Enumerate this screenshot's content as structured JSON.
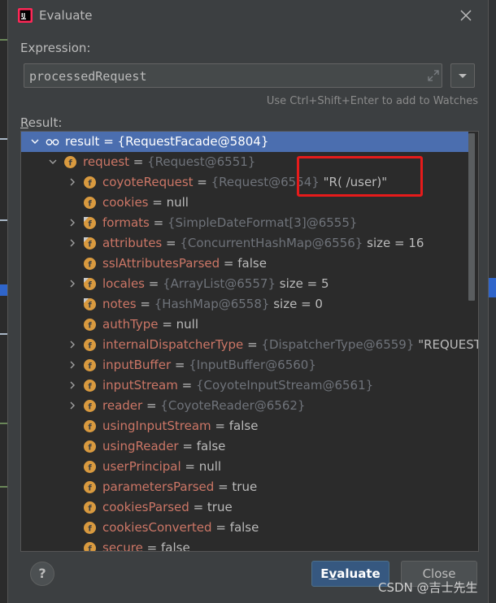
{
  "window": {
    "title": "Evaluate"
  },
  "expression": {
    "label": "Expression:",
    "value": "processedRequest",
    "hint": "Use Ctrl+Shift+Enter to add to Watches"
  },
  "result": {
    "label_pre": "R",
    "label_rest": "esult:",
    "rows": [
      {
        "arrow": "down",
        "icon": "watch",
        "name": "result",
        "ref": "{RequestFacade@5804}",
        "extra": ""
      },
      {
        "arrow": "down",
        "icon": "field",
        "name": "request",
        "ref": "{Request@6551}",
        "extra": ""
      },
      {
        "arrow": "right",
        "icon": "field",
        "name": "coyoteRequest",
        "ref": "{Request@6554}",
        "extra": "\"R( /user)\""
      },
      {
        "arrow": "",
        "icon": "field",
        "name": "cookies",
        "ref": "",
        "extra": "null"
      },
      {
        "arrow": "right",
        "icon": "field-static",
        "name": "formats",
        "ref": "{SimpleDateFormat[3]@6555}",
        "extra": ""
      },
      {
        "arrow": "right",
        "icon": "field-static",
        "name": "attributes",
        "ref": "{ConcurrentHashMap@6556}",
        "extra": "size = 16"
      },
      {
        "arrow": "",
        "icon": "field",
        "name": "sslAttributesParsed",
        "ref": "",
        "extra": "false"
      },
      {
        "arrow": "right",
        "icon": "field-static",
        "name": "locales",
        "ref": "{ArrayList@6557}",
        "extra": "size = 5"
      },
      {
        "arrow": "",
        "icon": "field-static",
        "name": "notes",
        "ref": "{HashMap@6558}",
        "extra": "size = 0"
      },
      {
        "arrow": "",
        "icon": "field",
        "name": "authType",
        "ref": "",
        "extra": "null"
      },
      {
        "arrow": "right",
        "icon": "field",
        "name": "internalDispatcherType",
        "ref": "{DispatcherType@6559}",
        "extra": "\"REQUEST\""
      },
      {
        "arrow": "right",
        "icon": "field",
        "name": "inputBuffer",
        "ref": "{InputBuffer@6560}",
        "extra": ""
      },
      {
        "arrow": "right",
        "icon": "field",
        "name": "inputStream",
        "ref": "{CoyoteInputStream@6561}",
        "extra": ""
      },
      {
        "arrow": "right",
        "icon": "field",
        "name": "reader",
        "ref": "{CoyoteReader@6562}",
        "extra": ""
      },
      {
        "arrow": "",
        "icon": "field",
        "name": "usingInputStream",
        "ref": "",
        "extra": "false"
      },
      {
        "arrow": "",
        "icon": "field",
        "name": "usingReader",
        "ref": "",
        "extra": "false"
      },
      {
        "arrow": "",
        "icon": "field",
        "name": "userPrincipal",
        "ref": "",
        "extra": "null"
      },
      {
        "arrow": "",
        "icon": "field",
        "name": "parametersParsed",
        "ref": "",
        "extra": "true"
      },
      {
        "arrow": "",
        "icon": "field",
        "name": "cookiesParsed",
        "ref": "",
        "extra": "true"
      },
      {
        "arrow": "",
        "icon": "field",
        "name": "cookiesConverted",
        "ref": "",
        "extra": "false"
      },
      {
        "arrow": "",
        "icon": "field",
        "name": "secure",
        "ref": "",
        "extra": "false"
      }
    ]
  },
  "buttons": {
    "help": "?",
    "evaluate_pre": "E",
    "evaluate_u": "v",
    "evaluate_rest": "aluate",
    "close": "Close"
  },
  "watermark": "CSDN @吉士先生",
  "colors": {
    "accent": "#4b6eaf",
    "field_name": "#cc7666",
    "field_icon": "#d99a3f",
    "highlight_box": "#e61b1b"
  }
}
